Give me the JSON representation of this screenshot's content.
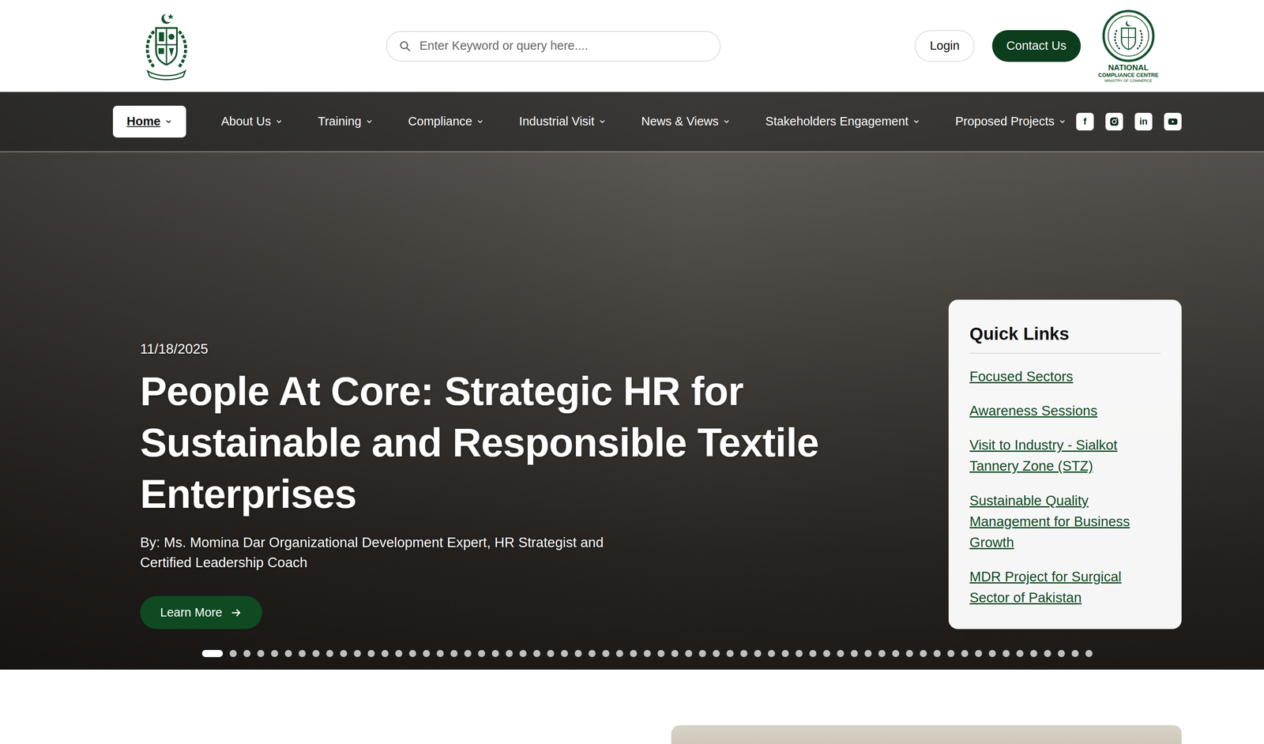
{
  "header": {
    "search": {
      "placeholder": "Enter Keyword or query here...."
    },
    "login": "Login",
    "contact": "Contact Us",
    "ncc_logo": {
      "line1": "NATIONAL",
      "line2": "COMPLIANCE CENTRE",
      "line3": "MINISTRY OF COMMERCE"
    }
  },
  "nav": {
    "items": [
      {
        "label": "Home",
        "selected": true,
        "has_menu": false
      },
      {
        "label": "About Us",
        "selected": false,
        "has_menu": false
      },
      {
        "label": "Training",
        "selected": false,
        "has_menu": true
      },
      {
        "label": "Compliance",
        "selected": false,
        "has_menu": true
      },
      {
        "label": "Industrial Visit",
        "selected": false,
        "has_menu": true
      },
      {
        "label": "News & Views",
        "selected": false,
        "has_menu": true
      },
      {
        "label": "Stakeholders Engagement",
        "selected": false,
        "has_menu": true
      },
      {
        "label": "Proposed Projects",
        "selected": false,
        "has_menu": true
      }
    ],
    "social": [
      {
        "kind": "facebook",
        "text": "f"
      },
      {
        "kind": "instagram"
      },
      {
        "kind": "linkedin",
        "text": "in"
      },
      {
        "kind": "youtube"
      }
    ]
  },
  "hero": {
    "date": "11/18/2025",
    "title": "People At Core: Strategic HR for Sustainable and Responsible Textile Enterprises",
    "byline": "By: Ms. Momina Dar Organizational Development Expert, HR Strategist and Certified Leadership Coach",
    "button": "Learn More",
    "slides": [
      {
        "selected": true
      },
      {
        "selected": false
      },
      {
        "selected": false
      },
      {
        "selected": false
      },
      {
        "selected": false
      },
      {
        "selected": false
      },
      {
        "selected": false
      },
      {
        "selected": false
      },
      {
        "selected": false
      },
      {
        "selected": false
      },
      {
        "selected": false
      },
      {
        "selected": false
      },
      {
        "selected": false
      },
      {
        "selected": false
      },
      {
        "selected": false
      },
      {
        "selected": false
      },
      {
        "selected": false
      },
      {
        "selected": false
      },
      {
        "selected": false
      },
      {
        "selected": false
      },
      {
        "selected": false
      },
      {
        "selected": false
      },
      {
        "selected": false
      },
      {
        "selected": false
      },
      {
        "selected": false
      },
      {
        "selected": false
      },
      {
        "selected": false
      },
      {
        "selected": false
      },
      {
        "selected": false
      },
      {
        "selected": false
      },
      {
        "selected": false
      },
      {
        "selected": false
      },
      {
        "selected": false
      },
      {
        "selected": false
      },
      {
        "selected": false
      },
      {
        "selected": false
      },
      {
        "selected": false
      },
      {
        "selected": false
      },
      {
        "selected": false
      },
      {
        "selected": false
      },
      {
        "selected": false
      },
      {
        "selected": false
      },
      {
        "selected": false
      },
      {
        "selected": false
      },
      {
        "selected": false
      },
      {
        "selected": false
      },
      {
        "selected": false
      },
      {
        "selected": false
      },
      {
        "selected": false
      },
      {
        "selected": false
      },
      {
        "selected": false
      },
      {
        "selected": false
      },
      {
        "selected": false
      },
      {
        "selected": false
      },
      {
        "selected": false
      },
      {
        "selected": false
      },
      {
        "selected": false
      },
      {
        "selected": false
      },
      {
        "selected": false
      },
      {
        "selected": false
      },
      {
        "selected": false
      },
      {
        "selected": false
      },
      {
        "selected": false
      },
      {
        "selected": false
      }
    ]
  },
  "quick_links": {
    "title": "Quick Links",
    "links": [
      "Focused Sectors",
      "Awareness Sessions",
      "Visit to Industry - Sialkot Tannery Zone (STZ)",
      "Sustainable Quality Management for Business Growth",
      "MDR Project for Surgical Sector of Pakistan"
    ]
  }
}
